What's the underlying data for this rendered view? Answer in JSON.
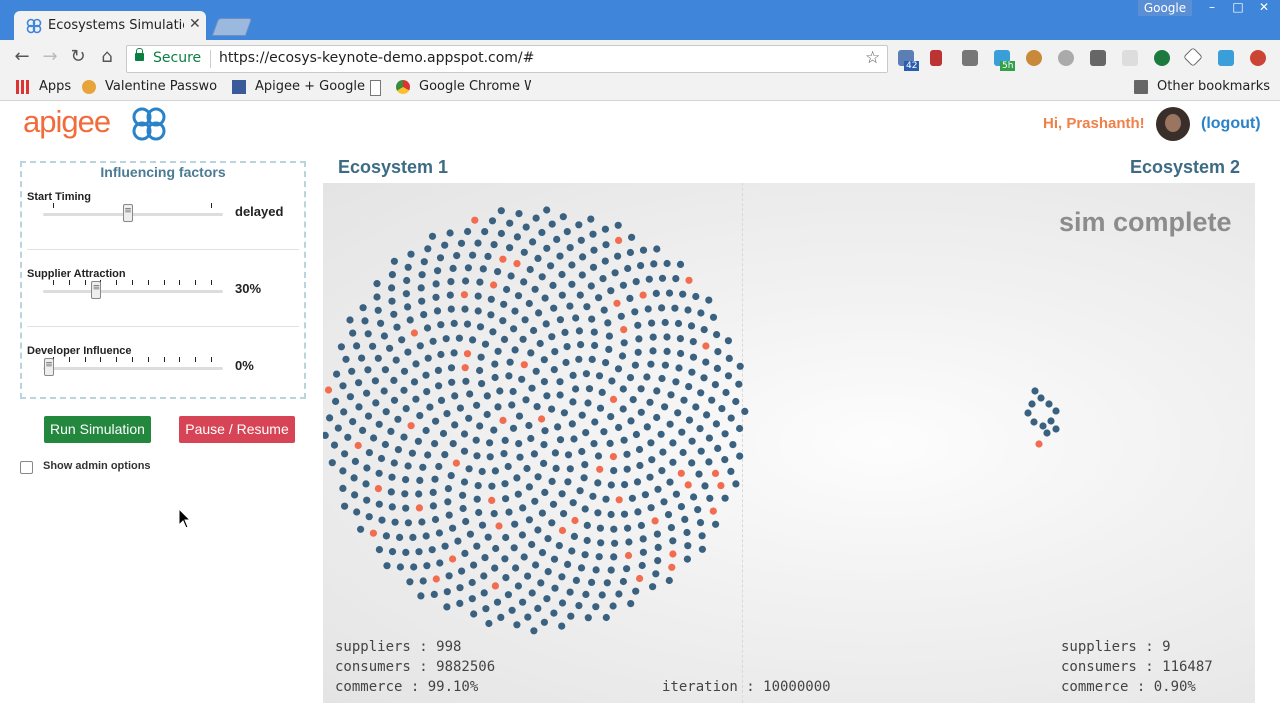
{
  "browser": {
    "tab_title": "Ecosystems Simulation",
    "profile": "Google",
    "secure_label": "Secure",
    "url": "https://ecosys-keynote-demo.appspot.com/#",
    "extension_badges": [
      "42",
      "5h"
    ],
    "bookmarks": [
      "Apps",
      "Valentine Password",
      "Apigee + Google",
      "Google Chrome We"
    ],
    "other_bookmarks": "Other bookmarks"
  },
  "header": {
    "logo": "apigee",
    "greeting": "Hi, Prashanth!",
    "logout": "(logout)"
  },
  "influencing": {
    "title": "Influencing factors",
    "factors": [
      {
        "label": "Start Timing",
        "value": "delayed",
        "ticks": 2,
        "position": 0.5
      },
      {
        "label": "Supplier Attraction",
        "value": "30%",
        "ticks": 11,
        "position": 0.3
      },
      {
        "label": "Developer Influence",
        "value": "0%",
        "ticks": 11,
        "position": 0.0
      }
    ]
  },
  "buttons": {
    "run": "Run Simulation",
    "pause": "Pause / Resume"
  },
  "admin": {
    "label": "Show admin options",
    "checked": false
  },
  "simulation": {
    "eco1_title": "Ecosystem 1",
    "eco2_title": "Ecosystem 2",
    "status": "sim complete",
    "eco1": {
      "suppliers": "suppliers : 998",
      "consumers": "consumers : 9882506",
      "commerce": "commerce : 99.10%"
    },
    "eco2": {
      "suppliers": "suppliers : 9",
      "consumers": "consumers : 116487",
      "commerce": "commerce : 0.90%"
    },
    "iteration": "iteration : 10000000",
    "colors": {
      "supplier": "#3a6180",
      "consumer": "#f26c4f"
    }
  }
}
